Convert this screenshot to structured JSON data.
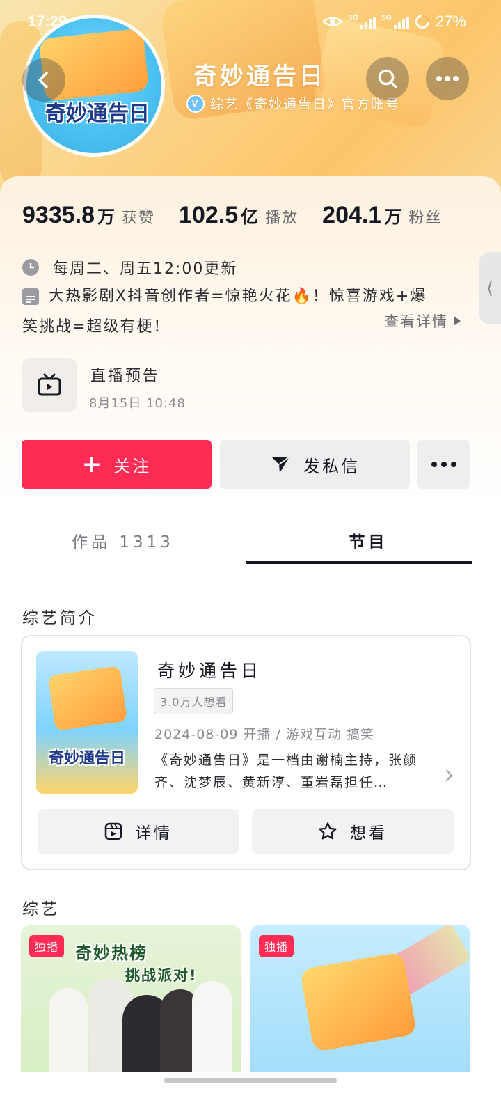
{
  "status_bar": {
    "time": "17:29",
    "network1": "5G",
    "network2": "5G",
    "battery": "27%"
  },
  "account": {
    "name": "奇妙通告日",
    "verified_text": "综艺《奇妙通告日》官方账号",
    "avatar_text": "奇妙通告日"
  },
  "stats": [
    {
      "num": "9335.8",
      "unit": "万",
      "label": "获赞"
    },
    {
      "num": "102.5",
      "unit": "亿",
      "label": "播放"
    },
    {
      "num": "204.1",
      "unit": "万",
      "label": "粉丝"
    }
  ],
  "info": {
    "schedule": "每周二、周五12:00更新",
    "desc_line1": "大热影剧X抖音创作者=惊艳火花🔥！惊喜游戏+爆",
    "desc_line2": "笑挑战=超级有梗！",
    "see_more": "查看详情"
  },
  "live": {
    "title": "直播预告",
    "time": "8月15日 10:48"
  },
  "actions": {
    "follow": "关注",
    "dm": "发私信"
  },
  "tabs": {
    "works": "作品 1313",
    "program": "节目"
  },
  "sections": {
    "intro": "综艺简介",
    "variety": "综艺"
  },
  "show": {
    "name": "奇妙通告日",
    "want_count": "3.0万人想看",
    "meta": "2024-08-09 开播 / 游戏互动 搞笑",
    "desc": "《奇妙通告日》是一档由谢楠主持，张颜齐、沈梦辰、黄新淳、董岩磊担任…",
    "poster_text": "奇妙通告日",
    "btn_detail": "详情",
    "btn_want": "想看"
  },
  "thumbs": [
    {
      "badge": "独播",
      "title": "奇妙热榜",
      "subtitle": "挑战派对!"
    },
    {
      "badge": "独播"
    }
  ],
  "colors": {
    "accent": "#fe2c55",
    "header": "#fcc56a"
  }
}
